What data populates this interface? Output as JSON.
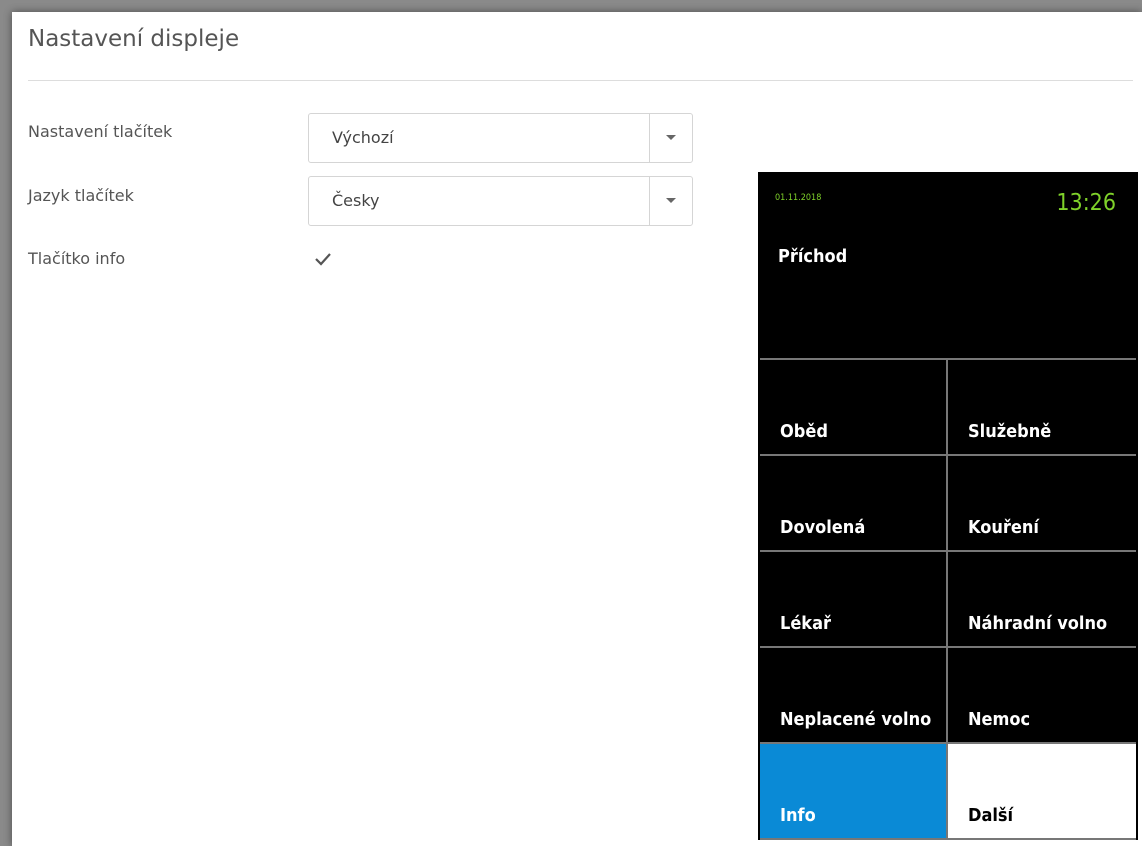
{
  "page": {
    "title": "Nastavení displeje"
  },
  "form": {
    "buttons_setting": {
      "label": "Nastavení tlačítek",
      "value": "Výchozí"
    },
    "buttons_language": {
      "label": "Jazyk tlačítek",
      "value": "Česky"
    },
    "info_button": {
      "label": "Tlačítko info",
      "checked": true
    }
  },
  "device": {
    "date": "01.11.2018",
    "time": "13:26",
    "state": "Příchod",
    "tiles": [
      "Oběd",
      "Služebně",
      "Dovolená",
      "Kouření",
      "Lékař",
      "Náhradní volno",
      "Neplacené volno",
      "Nemoc",
      "Info",
      "Další"
    ],
    "colors": {
      "clock_green": "#7fd12a",
      "info_blue": "#0a8ad6"
    }
  }
}
